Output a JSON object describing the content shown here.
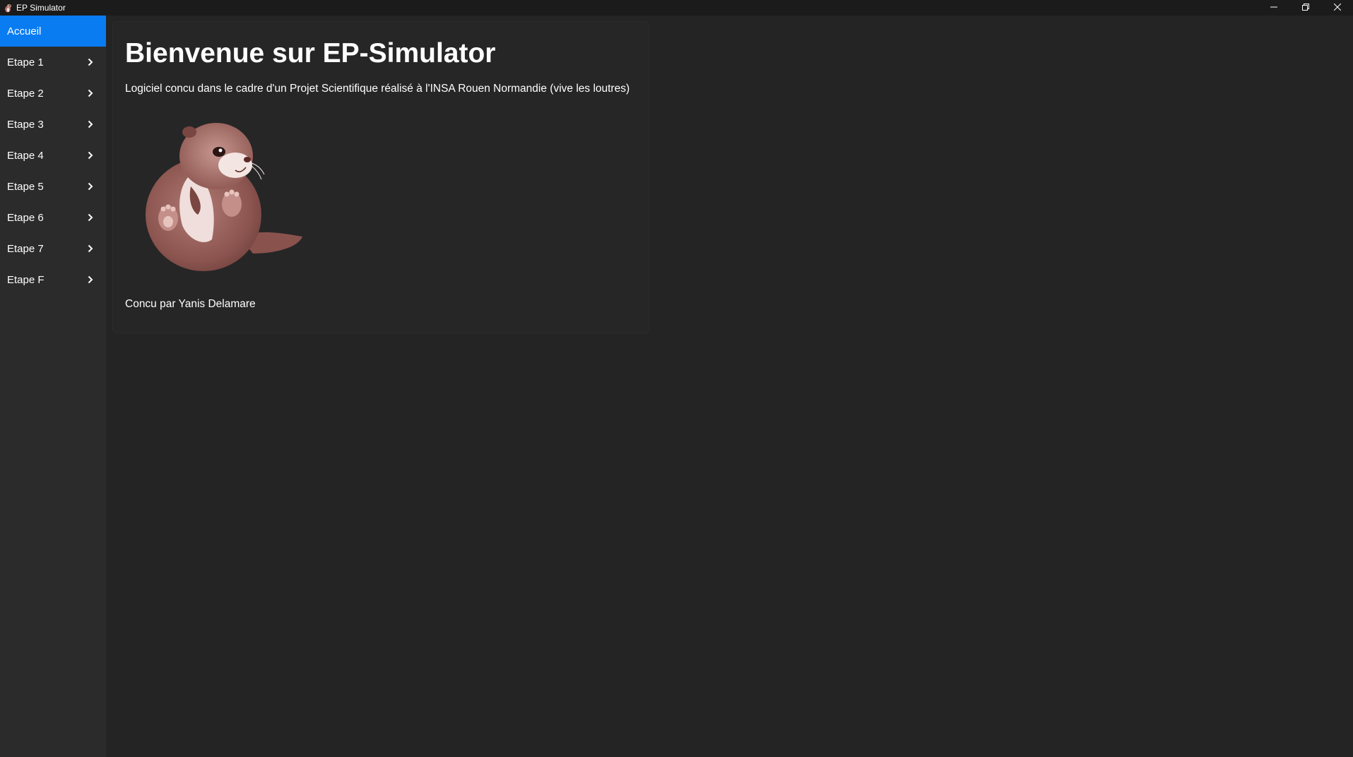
{
  "window": {
    "title": "EP Simulator",
    "icons": {
      "app": "otter-app-icon",
      "minimize": "minimize-icon",
      "maximize": "restore-icon",
      "close": "close-icon"
    }
  },
  "sidebar": {
    "items": [
      {
        "label": "Accueil",
        "active": true
      },
      {
        "label": "Etape 1",
        "expandable": true
      },
      {
        "label": "Etape 2",
        "expandable": true
      },
      {
        "label": "Etape 3",
        "expandable": true
      },
      {
        "label": "Etape 4",
        "expandable": true
      },
      {
        "label": "Etape 5",
        "expandable": true
      },
      {
        "label": "Etape 6",
        "expandable": true
      },
      {
        "label": "Etape 7",
        "expandable": true
      },
      {
        "label": "Etape F",
        "expandable": true
      }
    ],
    "chevron_icon": "chevron-right-icon"
  },
  "main": {
    "title": "Bienvenue sur EP-Simulator",
    "subtitle": "Logiciel concu dans le cadre d'un Projet Scientifique réalisé à l'INSA Rouen Normandie (vive les loutres)",
    "image": "otter-mascot",
    "credit": "Concu par Yanis Delamare"
  },
  "colors": {
    "accent": "#0a7cf2",
    "sidebar_bg": "#2b2b2b",
    "main_bg": "#242424",
    "titlebar_bg": "#1b1b1b",
    "text": "#ffffff"
  }
}
